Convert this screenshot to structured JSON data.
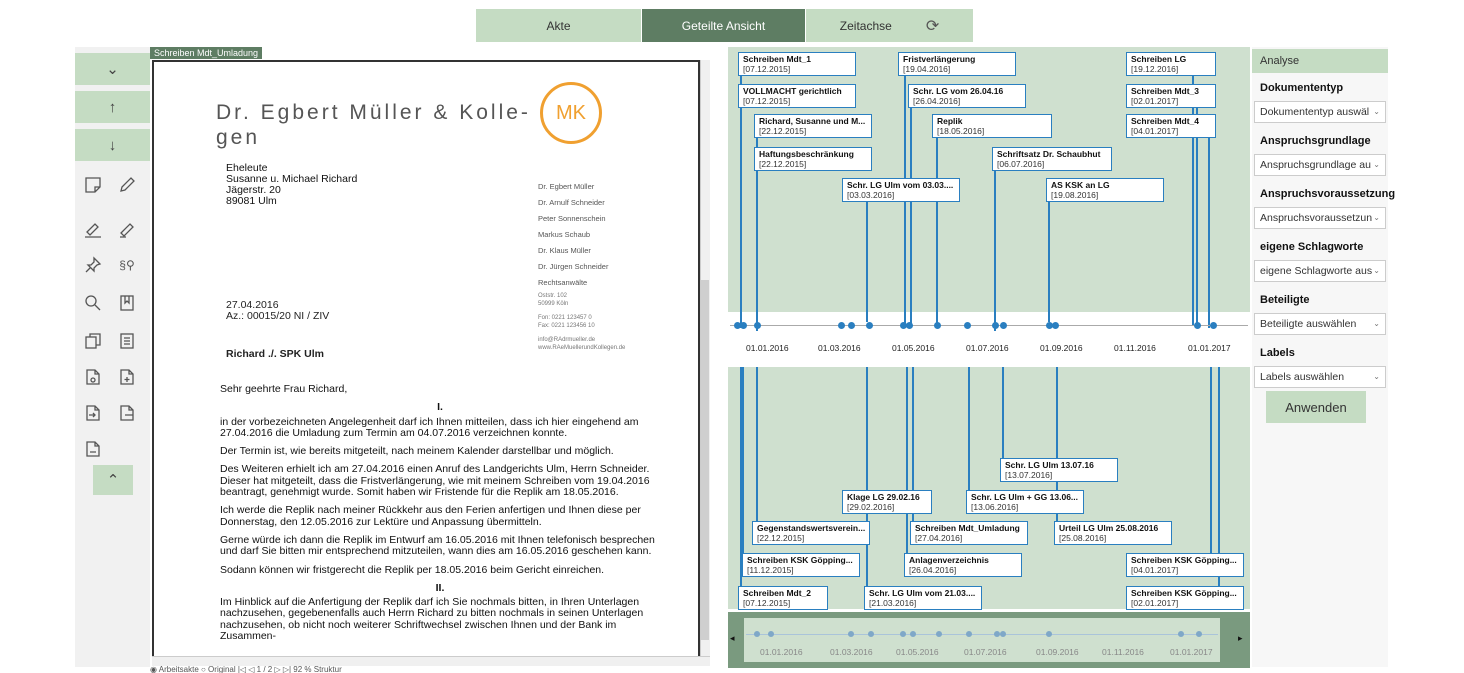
{
  "tabs": [
    {
      "label": "Akte"
    },
    {
      "label": "Geteilte Ansicht",
      "active": true
    },
    {
      "label": "Zeitachse"
    }
  ],
  "sync_icon": "sync-icon",
  "toolbar": {
    "collapse": "⌄",
    "up": "↑",
    "down": "↓",
    "expand": "^"
  },
  "document": {
    "tab_label": "Schreiben Mdt_Umladung",
    "firm_name": "Dr. Egbert Müller & Kolle- gen",
    "logo": "MK",
    "recipient": [
      "Eheleute",
      "Susanne u. Michael Richard",
      "Jägerstr. 20",
      "89081 Ulm"
    ],
    "lawyers": [
      "Dr. Egbert Müller",
      "Dr. Arnulf Schneider",
      "Peter Sonnenschein",
      "Markus Schaub",
      "Dr. Klaus Müller",
      "Dr. Jürgen Schneider",
      "Rechtsanwälte"
    ],
    "contact": [
      "Oststr. 102",
      "50999 Köln",
      "",
      "Fon: 0221 123457 0",
      "Fax: 0221 123456 10",
      "",
      "info@RAdrmueller.de",
      "www.RAeMuellerundKollegen.de"
    ],
    "date": "27.04.2016",
    "ref": "Az.: 00015/20 NI / ZIV",
    "subject": "Richard ./. SPK Ulm",
    "salutation": "Sehr geehrte Frau Richard,",
    "sec1": "I.",
    "p1": "in der vorbezeichneten Angelegenheit darf ich Ihnen mitteilen, dass ich hier eingehend am 27.04.2016 die Umladung zum Termin am 04.07.2016 verzeichnen konnte.",
    "p2": "Der Termin ist, wie bereits mitgeteilt, nach meinem Kalender darstellbar und möglich.",
    "p3": "Des Weiteren erhielt ich am 27.04.2016 einen Anruf des Landgerichts Ulm, Herrn Schneider. Dieser hat mitgeteilt, dass die Fristverlängerung, wie mit meinem Schreiben vom 19.04.2016 beantragt, genehmigt wurde. Somit haben wir Fristende für die Replik am 18.05.2016.",
    "p4": "Ich werde die Replik nach meiner Rückkehr aus den Ferien anfertigen und Ihnen diese per Donnerstag, den 12.05.2016 zur Lektüre und Anpassung übermitteln.",
    "p5": "Gerne würde ich dann die Replik im Entwurf am 16.05.2016 mit Ihnen telefonisch besprechen und darf Sie bitten mir entsprechend mitzuteilen, wann dies am 16.05.2016 geschehen kann.",
    "p6": "Sodann können wir fristgerecht die Replik per 18.05.2016 beim Gericht einreichen.",
    "sec2": "II.",
    "p7": "Im Hinblick auf die Anfertigung der Replik darf ich Sie nochmals bitten, in Ihren Unterlagen nachzusehen, gegebenenfalls auch Herrn Richard zu bitten nochmals in seinen Unterlagen nachzusehen, ob nicht noch weiterer Schriftwechsel zwischen Ihnen und der Bank im Zusammen-",
    "status": "◉ Arbeitsakte ○ Original      |◁ ◁ 1 / 2 ▷ ▷|  92 %      Struktur"
  },
  "timeline": {
    "axis_ticks": [
      "01.01.2016",
      "01.03.2016",
      "01.05.2016",
      "01.07.2016",
      "01.09.2016",
      "01.11.2016",
      "01.01.2017"
    ],
    "events_top": [
      {
        "title": "Schreiben Mdt_1",
        "date": "[07.12.2015]"
      },
      {
        "title": "VOLLMACHT gerichtlich",
        "date": "[07.12.2015]"
      },
      {
        "title": "Richard, Susanne und M...",
        "date": "[22.12.2015]"
      },
      {
        "title": "Haftungsbeschränkung",
        "date": "[22.12.2015]"
      },
      {
        "title": "Schr. LG Ulm vom 03.03....",
        "date": "[03.03.2016]"
      },
      {
        "title": "Fristverlängerung",
        "date": "[19.04.2016]"
      },
      {
        "title": "Schr. LG vom 26.04.16",
        "date": "[26.04.2016]"
      },
      {
        "title": "Replik",
        "date": "[18.05.2016]"
      },
      {
        "title": "Schriftsatz Dr. Schaubhut",
        "date": "[06.07.2016]"
      },
      {
        "title": "AS KSK an LG",
        "date": "[19.08.2016]"
      },
      {
        "title": "Schreiben LG",
        "date": "[19.12.2016]"
      },
      {
        "title": "Schreiben Mdt_3",
        "date": "[02.01.2017]"
      },
      {
        "title": "Schreiben Mdt_4",
        "date": "[04.01.2017]"
      }
    ],
    "events_bottom": [
      {
        "title": "Schr. LG Ulm 13.07.16",
        "date": "[13.07.2016]"
      },
      {
        "title": "Klage LG 29.02.16",
        "date": "[29.02.2016]"
      },
      {
        "title": "Schr. LG Ulm + GG 13.06...",
        "date": "[13.06.2016]"
      },
      {
        "title": "Gegenstandswertsverein...",
        "date": "[22.12.2015]"
      },
      {
        "title": "Schreiben Mdt_Umladung",
        "date": "[27.04.2016]"
      },
      {
        "title": "Urteil LG Ulm 25.08.2016",
        "date": "[25.08.2016]"
      },
      {
        "title": "Schreiben KSK Göpping...",
        "date": "[11.12.2015]"
      },
      {
        "title": "Anlagenverzeichnis",
        "date": "[26.04.2016]"
      },
      {
        "title": "Schreiben KSK Göpping...",
        "date": "[04.01.2017]"
      },
      {
        "title": "Schreiben Mdt_2",
        "date": "[07.12.2015]"
      },
      {
        "title": "Schr. LG Ulm vom 21.03....",
        "date": "[21.03.2016]"
      },
      {
        "title": "Schreiben KSK Göpping...",
        "date": "[02.01.2017]"
      }
    ],
    "nav_ticks": [
      "01.01.2016",
      "01.03.2016",
      "01.05.2016",
      "01.07.2016",
      "01.09.2016",
      "01.11.2016",
      "01.01.2017"
    ]
  },
  "analyse": {
    "header": "Analyse",
    "fields": [
      {
        "label": "Dokumententyp",
        "placeholder": "Dokumententyp auswäl"
      },
      {
        "label": "Anspruchsgrundlage",
        "placeholder": "Anspruchsgrundlage au"
      },
      {
        "label": "Anspruchsvoraussetzung",
        "placeholder": "Anspruchsvoraussetzun"
      },
      {
        "label": "eigene Schlagworte",
        "placeholder": "eigene Schlagworte aus"
      },
      {
        "label": "Beteiligte",
        "placeholder": "Beteiligte auswählen"
      },
      {
        "label": "Labels",
        "placeholder": "Labels auswählen"
      }
    ],
    "apply": "Anwenden"
  },
  "colors": {
    "accent_green": "#5e7d63",
    "light_green": "#c5dcc3",
    "timeline_bg": "#cfe0cf",
    "event_blue": "#2a7fc0"
  }
}
